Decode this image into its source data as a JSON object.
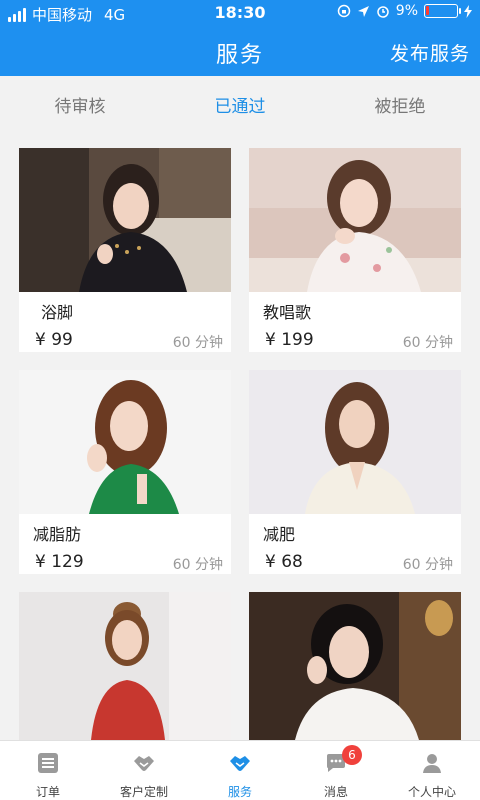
{
  "status_bar": {
    "carrier": "中国移动",
    "network": "4G",
    "time": "18:30",
    "battery": "9%",
    "battery_level": 0.09
  },
  "header": {
    "title": "服务",
    "action_label": "发布服务"
  },
  "tabs": [
    {
      "label": "待审核"
    },
    {
      "label": "已通过"
    },
    {
      "label": "被拒绝"
    }
  ],
  "active_tab": "已通过",
  "services": [
    {
      "title": "浴脚",
      "price": "¥ 99",
      "duration": "60 分钟"
    },
    {
      "title": "教唱歌",
      "price": "¥ 199",
      "duration": "60 分钟"
    },
    {
      "title": "减脂肪",
      "price": "¥ 129",
      "duration": "60 分钟"
    },
    {
      "title": "减肥",
      "price": "¥ 68",
      "duration": "60 分钟"
    },
    {
      "title": "",
      "price": "",
      "duration": ""
    },
    {
      "title": "",
      "price": "",
      "duration": ""
    }
  ],
  "bottom_nav": [
    {
      "label": "订单",
      "icon": "order-icon"
    },
    {
      "label": "客户定制",
      "icon": "handshake-icon"
    },
    {
      "label": "服务",
      "icon": "handshake-icon"
    },
    {
      "label": "消息",
      "icon": "chat-icon",
      "badge": "6"
    },
    {
      "label": "个人中心",
      "icon": "person-icon"
    }
  ],
  "colors": {
    "primary": "#1e90f0",
    "active_text": "#1e8fe6",
    "badge": "#f0413c"
  }
}
